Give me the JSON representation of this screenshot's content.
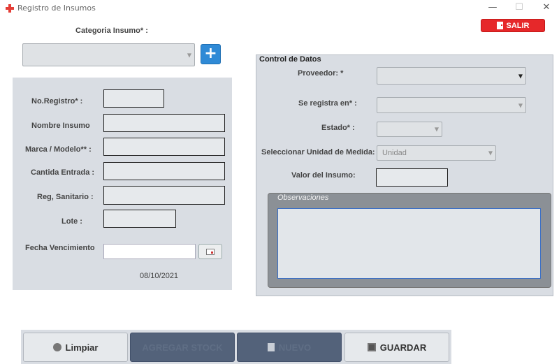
{
  "window": {
    "title": "Registro de Insumos",
    "minimize": "—",
    "maximize": "☐",
    "close": "✕"
  },
  "header": {
    "salir_label": "SALIR"
  },
  "categoria": {
    "label": "Categoria  Insumo* :",
    "value": "",
    "add_label": "+"
  },
  "registro_form": {
    "no_registro": {
      "label": "No.Registro* :",
      "value": ""
    },
    "nombre_insumo": {
      "label": "Nombre Insumo",
      "value": ""
    },
    "marca_modelo": {
      "label": "Marca / Modelo**  :",
      "value": ""
    },
    "cantidad_entrada": {
      "label": "Cantida Entrada :",
      "value": ""
    },
    "reg_sanitario": {
      "label": "Reg, Sanitario :",
      "value": ""
    },
    "lote": {
      "label": "Lote :",
      "value": ""
    },
    "fecha_vencimiento": {
      "label": "Fecha Vencimiento",
      "value": ""
    },
    "fecha_actual": "08/10/2021"
  },
  "control_datos": {
    "title": "Control de Datos",
    "proveedor": {
      "label": "Proveedor: *",
      "value": ""
    },
    "se_registra_en": {
      "label": "Se registra en* :",
      "value": ""
    },
    "estado": {
      "label": "Estado* :",
      "value": ""
    },
    "unidad_medida": {
      "label": "Seleccionar Unidad de Medida:",
      "value": "Unidad"
    },
    "valor_insumo": {
      "label": "Valor del Insumo:",
      "value": ""
    },
    "observaciones": {
      "label": "Observaciones",
      "value": ""
    }
  },
  "toolbar": {
    "limpiar": "Limpiar",
    "agregar_stock": "AGREGAR STOCK",
    "nuevo": "NUEVO",
    "guardar": "GUARDAR"
  },
  "colors": {
    "accent_red": "#e6282a",
    "accent_blue": "#2f8ad6",
    "panel_gray": "#d9dde3",
    "dark_button": "#53627a"
  },
  "icons": {
    "app": "red-cross-icon",
    "salir": "exit-door-icon",
    "add": "plus-icon",
    "calendar": "calendar-icon",
    "limpiar": "circle-icon",
    "nuevo": "document-icon",
    "guardar": "save-icon"
  }
}
